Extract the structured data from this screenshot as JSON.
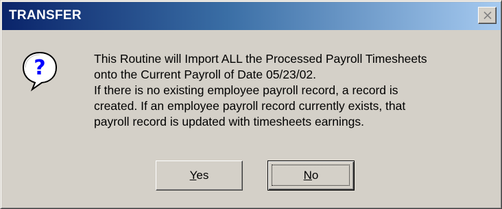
{
  "window": {
    "title": "TRANSFER",
    "close_icon": "close-icon"
  },
  "dialog": {
    "icon": "question-icon",
    "message_lines": [
      "This Routine will Import ALL the Processed Payroll Timesheets",
      "onto the Current Payroll of Date 05/23/02.",
      "If there is no existing employee payroll record, a record is",
      "created. If an employee payroll record currently exists, that",
      "payroll record is updated with timesheets earnings."
    ]
  },
  "buttons": {
    "yes": {
      "mnemonic": "Y",
      "rest": "es"
    },
    "no": {
      "mnemonic": "N",
      "rest": "o"
    },
    "focused": "no"
  }
}
